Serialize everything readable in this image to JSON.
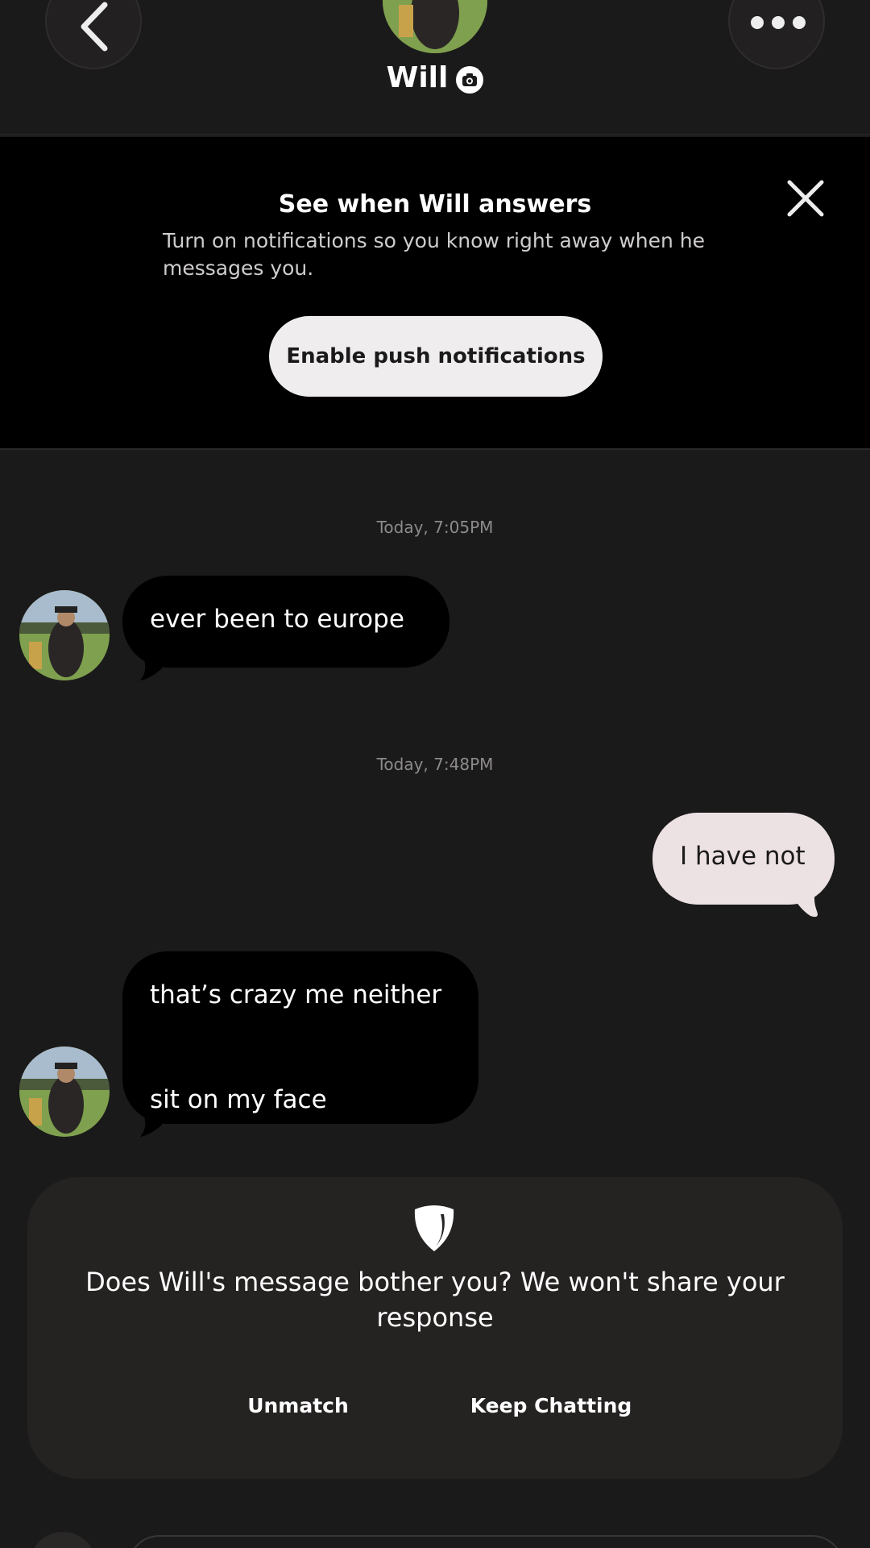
{
  "header": {
    "name": "Will",
    "icons": {
      "back": "chevron-left-icon",
      "more": "more-dots-icon",
      "badge": "camera-icon"
    }
  },
  "notification_banner": {
    "title": "See when Will answers",
    "text": "Turn on notifications so you know right away when he messages you.",
    "button_label": "Enable push notifications",
    "close_icon": "close-icon"
  },
  "chat": {
    "timestamps": [
      "Today, 7:05PM",
      "Today, 7:48PM"
    ],
    "messages": [
      {
        "from": "Will",
        "text": "ever been to europe"
      },
      {
        "from": "me",
        "text": "I have not"
      },
      {
        "from": "Will",
        "lines": [
          "that’s crazy me neither",
          "sit on my face"
        ]
      }
    ]
  },
  "safety_prompt": {
    "icon": "shield-icon",
    "text": "Does Will's message bother you? We won't share your response",
    "unmatch_label": "Unmatch",
    "keep_label": "Keep Chatting"
  },
  "colors": {
    "background": "#1b1a1a",
    "banner": "#000000",
    "incoming_bubble": "#000000",
    "outgoing_bubble": "#ece1e3",
    "card": "#252222",
    "enable_button": "#efedee"
  }
}
